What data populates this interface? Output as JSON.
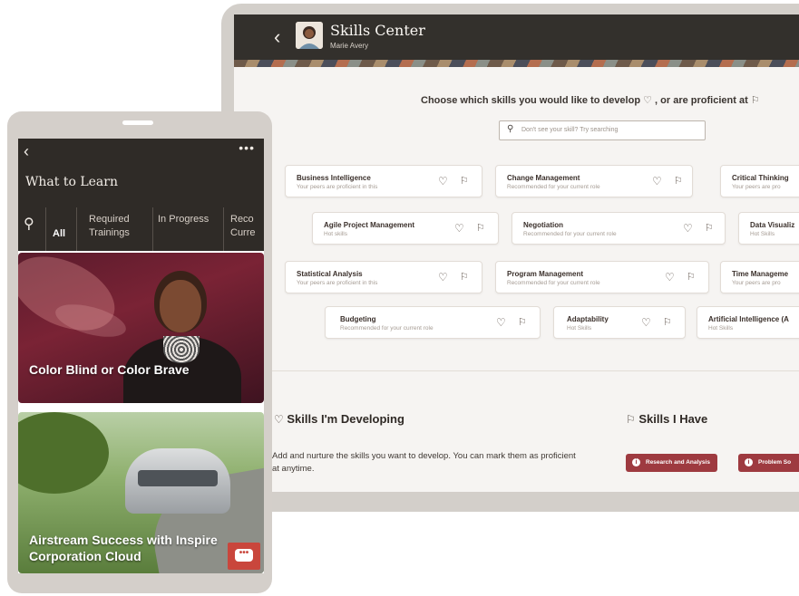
{
  "tablet": {
    "header": {
      "back_icon": "chevron-left-icon",
      "title": "Skills Center",
      "user_name": "Marie Avery"
    },
    "prompt": {
      "text_part1": "Choose which skills you would like to develop",
      "text_part2": ", or are proficient at",
      "heart_icon": "♡",
      "flag_icon": "⚐"
    },
    "search": {
      "placeholder": "Don't see your skill? Try searching"
    },
    "skills": [
      {
        "name": "Business Intelligence",
        "sub": "Your peers are proficient in this"
      },
      {
        "name": "Change Management",
        "sub": "Recommended for your current role"
      },
      {
        "name": "Critical Thinking",
        "sub": "Your peers are pro"
      },
      {
        "name": "Agile Project Management",
        "sub": "Hot skills"
      },
      {
        "name": "Negotiation",
        "sub": "Recommended for your current role"
      },
      {
        "name": "Data Visualiz",
        "sub": "Hot Skills"
      },
      {
        "name": "Statistical Analysis",
        "sub": "Your peers are proficient in this"
      },
      {
        "name": "Program Management",
        "sub": "Recommended for your current role"
      },
      {
        "name": "Time Manageme",
        "sub": "Your peers are pro"
      },
      {
        "name": "Budgeting",
        "sub": "Recommended for your current role"
      },
      {
        "name": "Adaptability",
        "sub": "Hot Skills"
      },
      {
        "name": "Artificial Intelligence (A",
        "sub": "Hot Skills"
      }
    ],
    "developing": {
      "icon": "♡",
      "heading": "Skills I'm Developing",
      "description": "Add and nurture the skills you want to develop. You can mark them as proficient at anytime."
    },
    "have": {
      "icon": "⚐",
      "heading": "Skills I Have",
      "chips": [
        "Research and Analysis",
        "Problem So"
      ]
    }
  },
  "phone": {
    "back_icon": "‹",
    "more_icon": "•••",
    "title": "What to Learn",
    "search_icon": "⚲",
    "tabs": [
      {
        "label": "All"
      },
      {
        "label": "Required Trainings"
      },
      {
        "label": "In Progress"
      },
      {
        "label": "Reco Curre"
      }
    ],
    "cards": [
      {
        "title": "Color Blind or Color Brave"
      },
      {
        "title": "Airstream Success with Inspire Corporation Cloud"
      }
    ],
    "chat_icon": "chat-bubble-icon"
  },
  "colors": {
    "header_dark": "#33302c",
    "accent_red": "#9e3a40",
    "chat_red": "#c9463c"
  }
}
